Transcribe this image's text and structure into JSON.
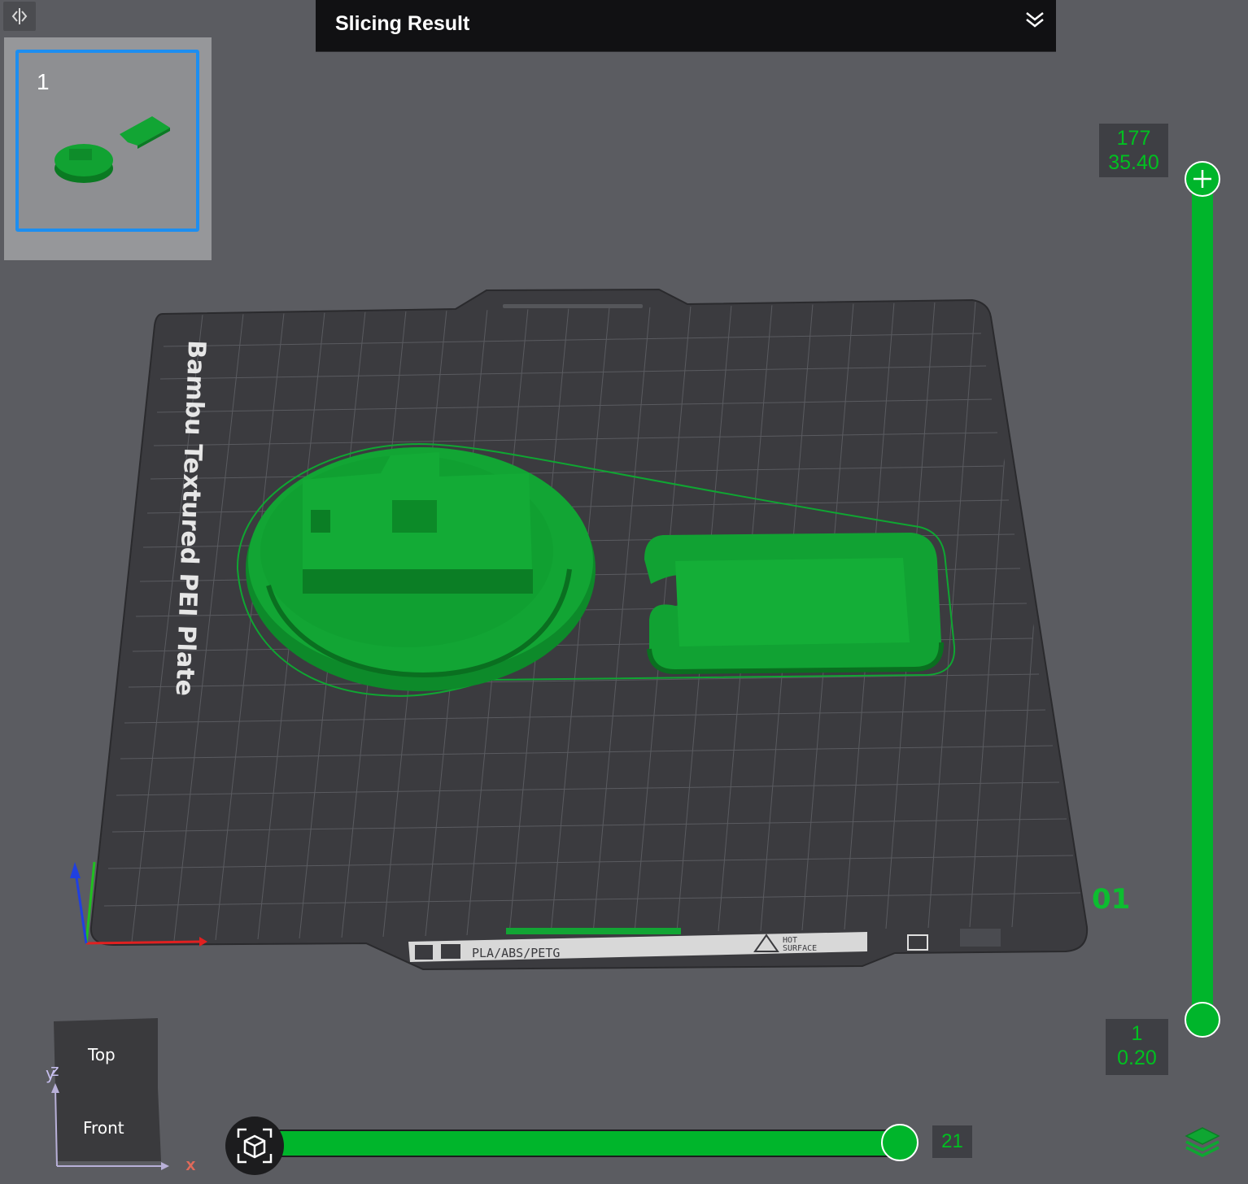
{
  "thumbnail": {
    "plate_number": "1"
  },
  "result_panel": {
    "title": "Slicing Result"
  },
  "plate": {
    "label": "Bambu Textured PEI Plate",
    "mark": "01",
    "badge_text": "PLA/ABS/PETG",
    "warning_line1": "HOT",
    "warning_line2": "SURFACE"
  },
  "layer_slider": {
    "top_layer": "177",
    "top_height": "35.40",
    "bottom_layer": "1",
    "bottom_height": "0.20"
  },
  "move_slider": {
    "value": "21"
  },
  "nav_cube": {
    "top": "Top",
    "front": "Front",
    "axis_y": "y",
    "axis_z": "z",
    "axis_x": "x"
  },
  "icons": [
    "collapse-panel-icon",
    "chevron-double-down-icon",
    "layers-icon",
    "view-toggle-icon",
    "plus-icon"
  ],
  "colors": {
    "accent": "#00b52b",
    "selection": "#1d8ef0",
    "background": "#5b5c61"
  }
}
